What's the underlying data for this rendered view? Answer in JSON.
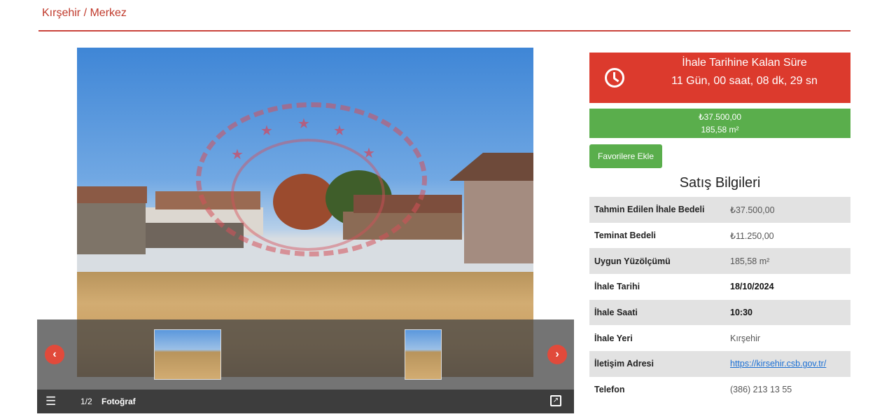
{
  "breadcrumb": "Kırşehir / Merkez",
  "gallery": {
    "counter": "1/2",
    "label": "Fotoğraf"
  },
  "timer": {
    "title": "İhale Tarihine Kalan Süre",
    "value": "11 Gün, 00 saat, 08 dk, 29 sn"
  },
  "price": {
    "amount": "₺37.500,00",
    "area": "185,58 m²"
  },
  "favorite_button": "Favorilere Ekle",
  "section_title": "Satış Bilgileri",
  "info": [
    {
      "key": "Tahmin Edilen İhale Bedeli",
      "value": "₺37.500,00"
    },
    {
      "key": "Teminat Bedeli",
      "value": "₺11.250,00"
    },
    {
      "key": "Uygun Yüzölçümü",
      "value": "185,58 m²"
    },
    {
      "key": "İhale Tarihi",
      "value": "18/10/2024"
    },
    {
      "key": "İhale Saati",
      "value": "10:30"
    },
    {
      "key": "İhale Yeri",
      "value": "Kırşehir"
    },
    {
      "key": "İletişim Adresi",
      "value": "https://kirsehir.csb.gov.tr/"
    },
    {
      "key": "Telefon",
      "value": "(386) 213 13 55"
    }
  ],
  "colors": {
    "accent_red": "#dc3a2d",
    "accent_green": "#5aae4c"
  },
  "icons": {
    "timer": "clock-icon",
    "prev": "chevron-left-icon",
    "next": "chevron-right-icon",
    "menu": "hamburger-icon",
    "fullscreen": "expand-icon"
  }
}
